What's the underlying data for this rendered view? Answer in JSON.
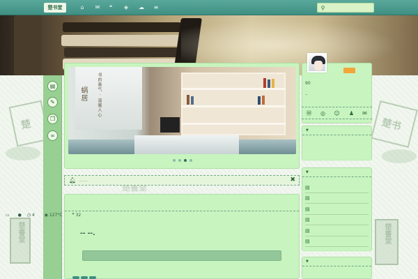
{
  "topnav": {
    "logo_text": "楚书堂",
    "icons": [
      "home-icon",
      "chat-icon",
      "tag-icon",
      "cloud-icon"
    ],
    "search": {
      "placeholder": "",
      "value": ""
    }
  },
  "left_rail": {
    "icons": [
      "document-icon",
      "edit-icon",
      "book-icon",
      "link-icon"
    ]
  },
  "slider": {
    "slide_text_main": "蜗居",
    "slide_text_sub": "书的香气 · 温暖人心",
    "dots": 4,
    "active_dot": 2
  },
  "notice": {
    "text": "........"
  },
  "post": {
    "meta_comments": "4",
    "meta_views": "127°C",
    "meta_replies": "32",
    "title": "-- --."
  },
  "profile": {
    "stat": "90",
    "subtitle": "..",
    "social_icons": [
      "wordpress-icon",
      "weibo-icon",
      "wechat-icon",
      "qq-icon",
      "mail-icon"
    ]
  },
  "seals": {
    "text": "楚書堂"
  },
  "colors": {
    "nav": "#3f8f83",
    "panel": "#c8f4bf",
    "rail": "#98cf92",
    "badge": "#f3a63a"
  }
}
